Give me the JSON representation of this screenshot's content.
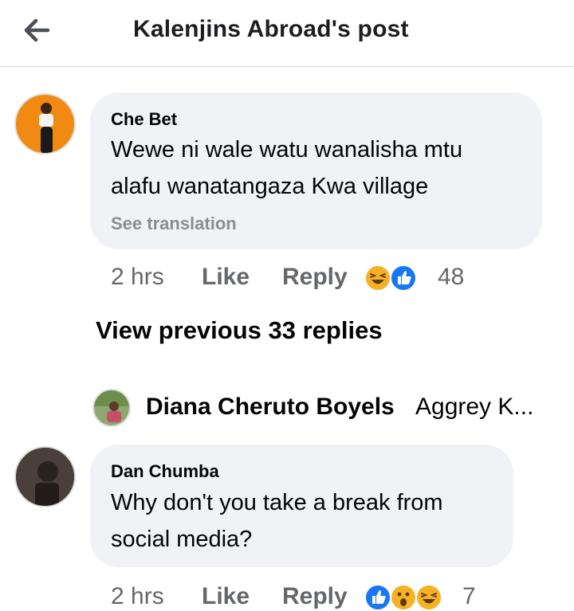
{
  "header": {
    "title": "Kalenjins Abroad's post",
    "back_icon": "arrow-left-icon"
  },
  "comments": [
    {
      "author": "Che Bet",
      "text_line1": "Wewe ni wale watu wanalisha mtu",
      "text_line2": "alafu  wanatangaza Kwa village",
      "see_translation": "See translation",
      "time": "2 hrs",
      "like_label": "Like",
      "reply_label": "Reply",
      "reactions": [
        "haha-icon",
        "like-icon"
      ],
      "reaction_count": "48"
    },
    {
      "author": "Dan Chumba",
      "text_line1": "Why don't you take a break from",
      "text_line2": "social media?",
      "time": "2 hrs",
      "like_label": "Like",
      "reply_label": "Reply",
      "reactions": [
        "like-icon",
        "wow-icon",
        "haha-icon"
      ],
      "reaction_count": "7"
    }
  ],
  "view_previous": "View previous 33 replies",
  "reply_preview": {
    "author": "Diana Cheruto Boyels",
    "text": "Aggrey K..."
  },
  "colors": {
    "like_blue": "#1877f2",
    "emoji_yellow": "#f7b125",
    "bubble": "#f0f2f5",
    "muted": "#65676b"
  }
}
